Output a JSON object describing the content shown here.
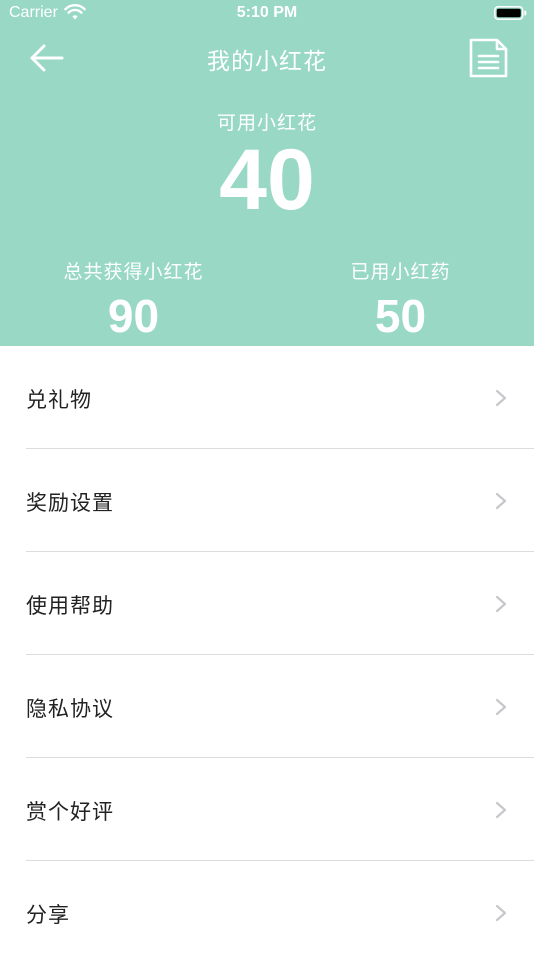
{
  "status_bar": {
    "carrier": "Carrier",
    "time": "5:10 PM"
  },
  "nav": {
    "title": "我的小红花"
  },
  "summary": {
    "available_label": "可用小红花",
    "available_value": "40",
    "total_label": "总共获得小红花",
    "total_value": "90",
    "used_label": "已用小红药",
    "used_value": "50"
  },
  "menu": {
    "items": [
      {
        "label": "兑礼物"
      },
      {
        "label": "奖励设置"
      },
      {
        "label": "使用帮助"
      },
      {
        "label": "隐私协议"
      },
      {
        "label": "赏个好评"
      },
      {
        "label": "分享"
      }
    ]
  },
  "colors": {
    "header_bg": "#98d8c5",
    "header_text": "#ffffff",
    "menu_text": "#222222",
    "divider": "#dcdcdc",
    "chevron": "#c7c7cc"
  },
  "icons": {
    "back": "arrow-left-icon",
    "document": "document-icon",
    "chevron": "chevron-right-icon",
    "wifi": "wifi-icon",
    "battery": "battery-icon"
  }
}
